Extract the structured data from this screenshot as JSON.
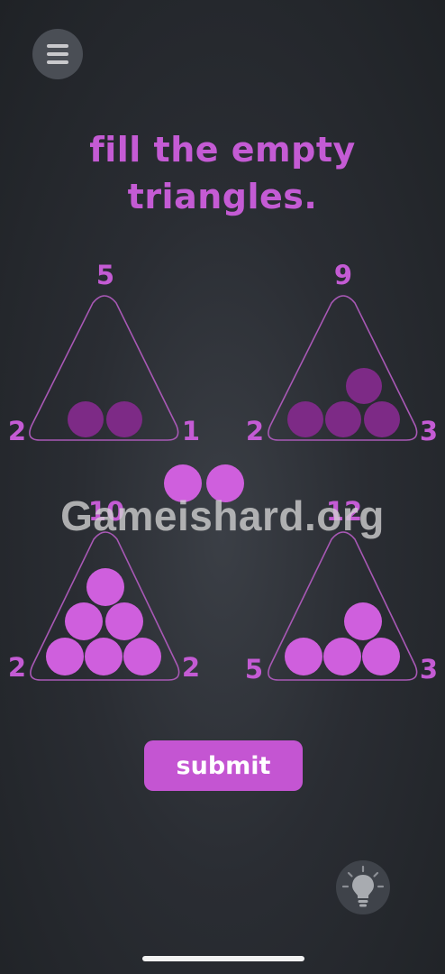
{
  "menu": {
    "icon": "hamburger-menu-icon"
  },
  "title": {
    "line1": "fill the empty",
    "line2": "triangles."
  },
  "colors": {
    "accent": "#c45bd4",
    "filled_ball": "#cf5fdd",
    "dark_ball": "#7d2a86",
    "background": "#2a2d33"
  },
  "triangles": [
    {
      "top": "5",
      "left": "2",
      "right": "1",
      "balls": 2,
      "state": "dim"
    },
    {
      "top": "9",
      "left": "2",
      "right": "3",
      "balls": 4,
      "state": "dim"
    },
    {
      "top": "10",
      "left": "2",
      "right": "2",
      "balls": 6,
      "state": "filled"
    },
    {
      "top": "12",
      "left": "5",
      "right": "3",
      "balls": 4,
      "state": "filled"
    }
  ],
  "floating_balls": 2,
  "watermark": "Gameishard.org",
  "submit": {
    "label": "submit"
  },
  "hint": {
    "icon": "lightbulb-icon"
  }
}
